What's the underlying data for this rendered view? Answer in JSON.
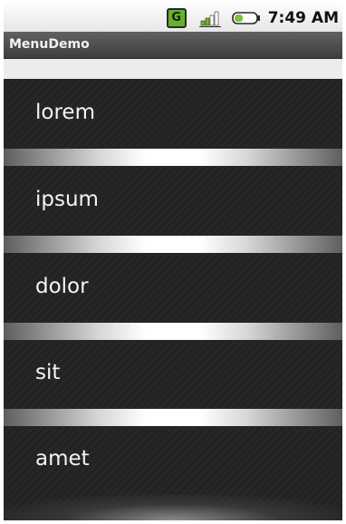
{
  "status_bar": {
    "notification_icon": "G",
    "time": "7:49 AM",
    "icons": [
      "g-notification-icon",
      "signal-icon",
      "battery-icon"
    ]
  },
  "app": {
    "title": "MenuDemo"
  },
  "list": {
    "items": [
      {
        "label": "lorem"
      },
      {
        "label": "ipsum"
      },
      {
        "label": "dolor"
      },
      {
        "label": "sit"
      },
      {
        "label": "amet"
      }
    ]
  },
  "colors": {
    "background": "#232323",
    "text": "#f4f4f4",
    "title_bar": "#4d4d4d",
    "notification_green": "#64b32a",
    "battery_green": "#7cc43a"
  }
}
